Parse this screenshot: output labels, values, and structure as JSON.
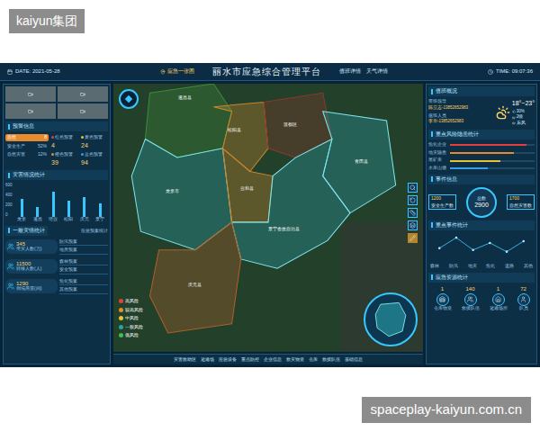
{
  "watermark": {
    "top": "kaiyun集团",
    "bottom": "spaceplay-kaiyun.com.cn"
  },
  "header": {
    "date": "DATE: 2021-05-28",
    "title": "丽水市应急综合管理平台",
    "time": "TIME: 09:07:36",
    "nav": [
      {
        "label": "应急一张图",
        "selected": true
      },
      {
        "label": "值班详情",
        "selected": false
      },
      {
        "label": "天气详情",
        "selected": false
      }
    ]
  },
  "left": {
    "warning": {
      "title": "预警信息",
      "rows": [
        {
          "label": "自然",
          "value": "8",
          "selected": true
        },
        {
          "label": "安全生产",
          "value": "52%",
          "selected": false
        },
        {
          "label": "自然灾害",
          "value": "12%",
          "selected": false
        }
      ],
      "levels": [
        {
          "label": "红色预警",
          "value": "4",
          "color": "#e04040"
        },
        {
          "label": "黄色预警",
          "value": "24",
          "color": "#e6c13a"
        },
        {
          "label": "橙色预警",
          "value": "39",
          "color": "#e88a2e"
        },
        {
          "label": "蓝色预警",
          "value": "94",
          "color": "#3a9be6"
        }
      ]
    },
    "chart": {
      "title": "灾害情况统计",
      "ticks": [
        "600",
        "400",
        "200",
        "0"
      ],
      "max": 600,
      "categories": [
        "龙泉",
        "遂昌",
        "缙云",
        "松阳",
        "庆元",
        "景宁"
      ],
      "values": [
        320,
        180,
        450,
        280,
        350,
        240
      ]
    },
    "stats": {
      "title": "一般灾情统计",
      "subtitle": "应急预案统计",
      "rows": [
        {
          "value": "345",
          "label": "受灾人数(万)",
          "items": [
            "防汛预案",
            "地质预案"
          ]
        },
        {
          "value": "11500",
          "label": "转移人数(人)",
          "items": [
            "森林预案",
            "安全预案"
          ]
        },
        {
          "value": "1290",
          "label": "倒塌房屋(间)",
          "items": [
            "危化预案",
            "其他预案"
          ]
        }
      ]
    }
  },
  "map": {
    "regions": [
      {
        "name": "遂昌县",
        "color": "#3f8a3a"
      },
      {
        "name": "松阳县",
        "color": "#c9862e"
      },
      {
        "name": "莲都区",
        "color": "#8a3a2a"
      },
      {
        "name": "青田县",
        "color": "#2aa0a8"
      },
      {
        "name": "龙泉市",
        "color": "#2aa0a8"
      },
      {
        "name": "云和县",
        "color": "#c9862e"
      },
      {
        "name": "景宁畲族自治县",
        "color": "#2aa0a8"
      },
      {
        "name": "庆元县",
        "color": "#b0602a"
      }
    ],
    "legend": [
      {
        "label": "高风险",
        "color": "#e04040"
      },
      {
        "label": "较高风险",
        "color": "#e88a2e"
      },
      {
        "label": "中风险",
        "color": "#e6c13a"
      },
      {
        "label": "一般风险",
        "color": "#2aa0a8"
      },
      {
        "label": "低风险",
        "color": "#3fbf4a"
      }
    ],
    "bottom_nav": [
      {
        "label": "灾害救助区",
        "selected": false
      },
      {
        "label": "避难场",
        "selected": false
      },
      {
        "label": "应急设备",
        "selected": false
      },
      {
        "label": "重点防控",
        "selected": false
      },
      {
        "label": "企业信息",
        "selected": false
      },
      {
        "label": "救灾物资",
        "selected": false
      },
      {
        "label": "仓库",
        "selected": false
      },
      {
        "label": "救援队伍",
        "selected": false
      },
      {
        "label": "基础信息",
        "selected": false
      }
    ]
  },
  "right": {
    "duty": {
      "title": "值班概况",
      "rows": [
        {
          "label": "带班领导",
          "value": "陈立志-13852652983"
        },
        {
          "label": "值班人员",
          "value": "李华-13852652983"
        }
      ]
    },
    "weather": {
      "temp": "18°~23°",
      "details": [
        "30%",
        "2级",
        "东风"
      ]
    },
    "risk": {
      "title": "重点风险隐患统计",
      "rows": [
        {
          "label": "危化企业",
          "level": 0.9,
          "color": "#e04040"
        },
        {
          "label": "地灾隐患",
          "level": 0.75,
          "color": "#e88a2e"
        },
        {
          "label": "尾矿库",
          "level": 0.6,
          "color": "#e6c13a"
        },
        {
          "label": "水库山塘",
          "level": 0.45,
          "color": "#3a9be6"
        }
      ]
    },
    "events": {
      "title": "事件信息",
      "total_label": "总数",
      "total": "2900",
      "a": {
        "value": "1700",
        "label": "自然灾害数"
      },
      "b": {
        "value": "1200",
        "label": "安全生产数"
      }
    },
    "line": {
      "title": "重点事件统计",
      "labels": [
        "森林",
        "防汛",
        "地灾",
        "危化",
        "道路",
        "其他"
      ],
      "values": [
        40,
        70,
        35,
        55,
        30,
        60
      ]
    },
    "resources": {
      "title": "应急资源统计",
      "items": [
        {
          "label": "仓库物资",
          "value": "1"
        },
        {
          "label": "救援队伍",
          "value": "140"
        },
        {
          "label": "避难场所",
          "value": "1"
        },
        {
          "label": "队员",
          "value": "72"
        }
      ]
    }
  }
}
